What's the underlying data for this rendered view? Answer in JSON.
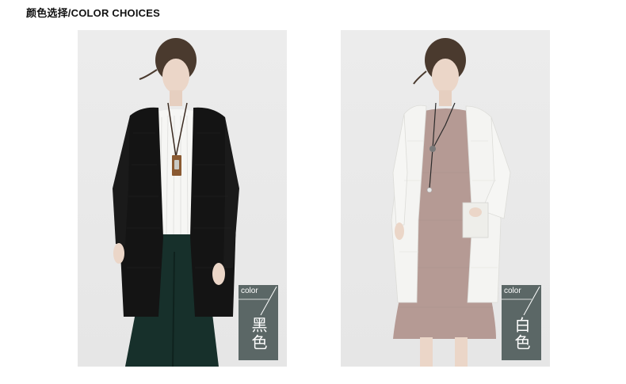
{
  "section": {
    "title": "颜色选择/COLOR CHOICES"
  },
  "products": [
    {
      "tag_word": "color",
      "color_name": "黑色",
      "garment_color": "#141414"
    },
    {
      "tag_word": "color",
      "color_name": "白色",
      "garment_color": "#f4f4f2"
    }
  ],
  "colors": {
    "tag_background": "#5b6766",
    "photo_background": "#e8e8e8"
  }
}
